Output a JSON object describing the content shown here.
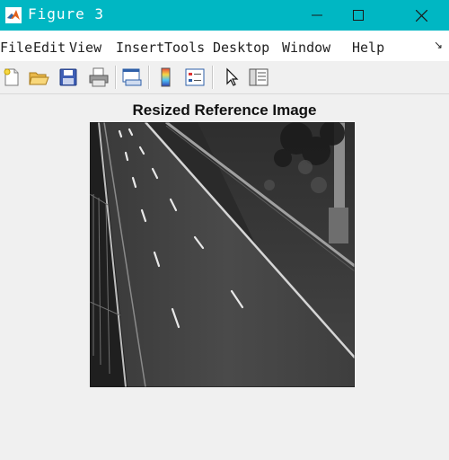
{
  "window": {
    "title": "Figure 3"
  },
  "menu": {
    "items": [
      "File",
      "Edit",
      "View",
      "Insert",
      "Tools",
      "Desktop",
      "Window",
      "Help"
    ]
  },
  "toolbar": {
    "buttons": [
      "new-figure-icon",
      "open-folder-icon",
      "save-icon",
      "print-icon",
      "link-plot-icon",
      "insert-colorbar-icon",
      "insert-legend-icon",
      "select-arrow-icon",
      "property-inspector-icon"
    ]
  },
  "axes": {
    "title": "Resized Reference Image"
  },
  "colors": {
    "titlebar": "#00b7c3",
    "menubar": "#ffffff",
    "figure_bg": "#f0f0f0"
  }
}
